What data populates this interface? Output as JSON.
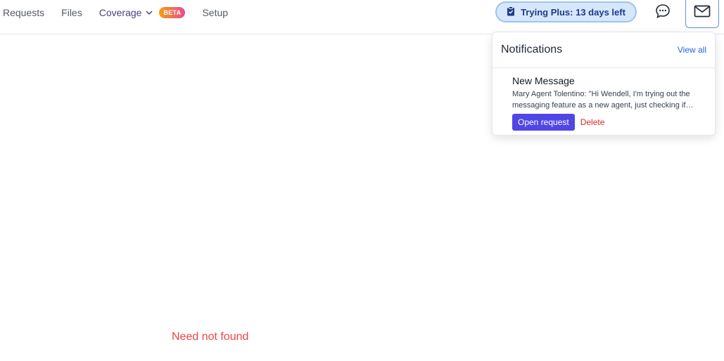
{
  "nav": {
    "requests": "Requests",
    "files": "Files",
    "coverage": "Coverage",
    "beta": "BETA",
    "setup": "Setup"
  },
  "trial": {
    "label": "Trying Plus: 13 days left"
  },
  "notifications": {
    "title": "Notifications",
    "view_all": "View all",
    "items": [
      {
        "title": "New Message",
        "body": "Mary Agent Tolentino: \"Hi Wendell, I'm trying out the messaging feature as a new agent, just checking if everything works as expected\"",
        "open_label": "Open request",
        "delete_label": "Delete"
      }
    ]
  },
  "main": {
    "error": "Need not found"
  },
  "colors": {
    "accent": "#4f46e5",
    "trial_bg": "#d7e7fb",
    "trial_text": "#1e3a8a",
    "error": "#ef4444",
    "link": "#2563eb",
    "delete": "#dc2626"
  },
  "icons": {
    "trial": "clipboard-check-icon",
    "chat": "chat-bubble-icon",
    "mail": "envelope-icon",
    "coverage": "chevron-down-icon"
  }
}
